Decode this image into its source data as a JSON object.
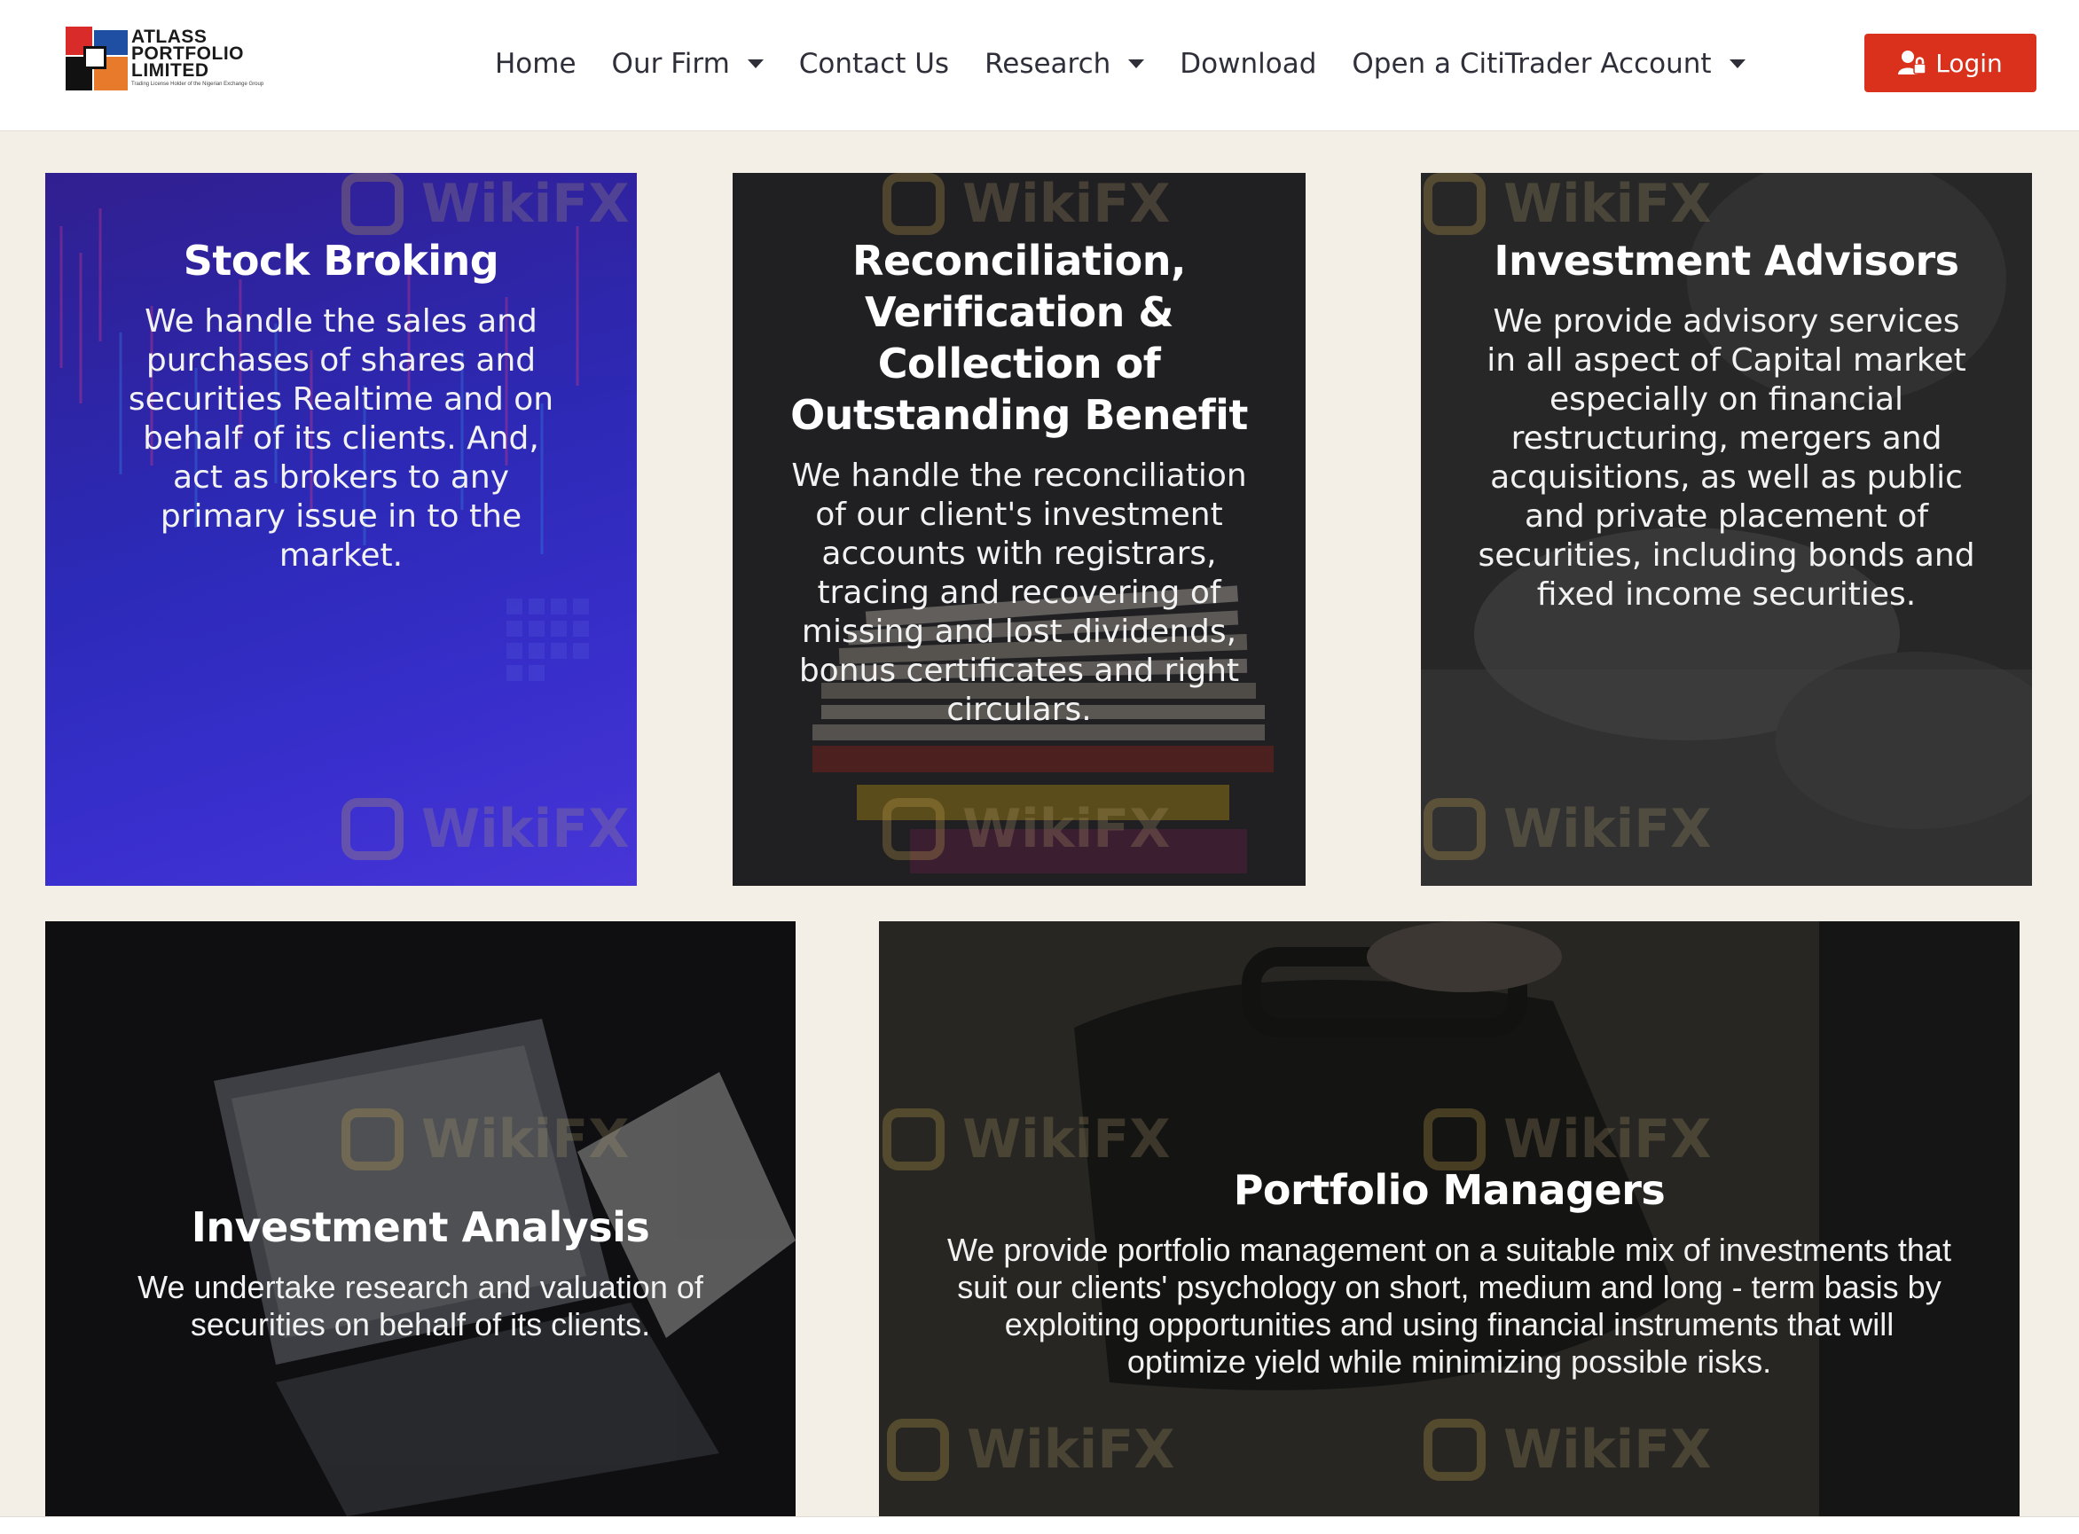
{
  "header": {
    "logo": {
      "lines": [
        "ATLASS",
        "PORTFOLIO",
        "LIMITED"
      ],
      "tagline": "Trading License Holder of the Nigerian Exchange Group"
    },
    "nav": [
      {
        "label": "Home",
        "dropdown": false
      },
      {
        "label": "Our Firm",
        "dropdown": true
      },
      {
        "label": "Contact Us",
        "dropdown": false
      },
      {
        "label": "Research",
        "dropdown": true
      },
      {
        "label": "Download",
        "dropdown": false
      },
      {
        "label": "Open a CitiTrader Account",
        "dropdown": true
      }
    ],
    "login": {
      "label": "Login",
      "icon": "user-lock-icon"
    }
  },
  "cards": [
    {
      "title": "Stock Broking",
      "description": "We handle the sales and purchases of shares and securities Realtime and on behalf of its clients. And, act as brokers to any primary issue in to the market."
    },
    {
      "title": "Reconciliation, Verification & Collection of Outstanding Benefit",
      "description": "We handle the reconciliation of our client's investment accounts with registrars, tracing and recovering of missing and lost dividends, bonus certificates and right circulars."
    },
    {
      "title": "Investment Advisors",
      "description": "We provide advisory services in all aspect of Capital market especially on financial restructuring, mergers and acquisitions, as well as public and private placement of securities, including bonds and fixed income securities."
    },
    {
      "title": "Investment Analysis",
      "description": "We undertake research and valuation of securities on behalf of its clients."
    },
    {
      "title": "Portfolio Managers",
      "description": "We provide portfolio management on a suitable mix of investments that suit our clients' psychology on short, medium and long - term basis by exploiting opportunities and using financial instruments that will optimize yield while minimizing possible risks."
    }
  ],
  "watermark": {
    "text": "WikiFX"
  },
  "colors": {
    "accent": "#d9311c",
    "page_bg": "#f3eee6",
    "nav_text": "#2f2f3a"
  }
}
